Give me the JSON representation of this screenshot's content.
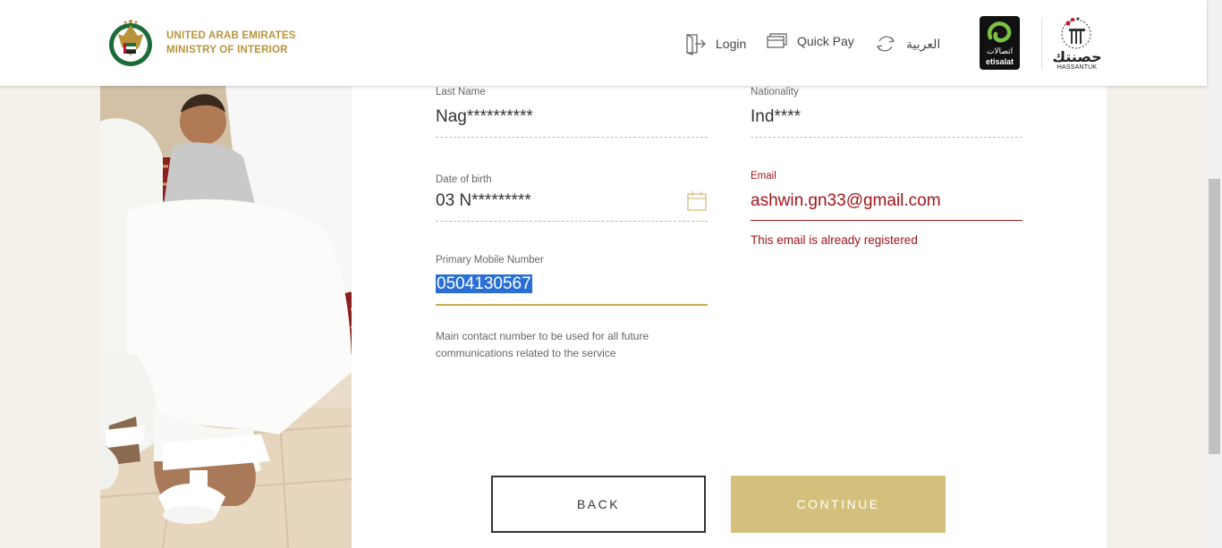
{
  "header": {
    "brand_line1": "UNITED ARAB EMIRATES",
    "brand_line2": "MINISTRY OF INTERIOR",
    "nav": {
      "login": "Login",
      "quick_pay": "Quick Pay",
      "language": "العربية"
    },
    "partners": {
      "etisalat_ar": "اتصالات",
      "etisalat_en": "etisalat",
      "hassantuk_ar": "حصنتك",
      "hassantuk_en": "HASSANTUK"
    }
  },
  "form": {
    "last_name": {
      "label": "Last Name",
      "value": "Nag**********"
    },
    "nationality": {
      "label": "Nationality",
      "value": "Ind****"
    },
    "dob": {
      "label": "Date of birth",
      "value": "03 N*********"
    },
    "email": {
      "label": "Email",
      "value": "ashwin.gn33@gmail.com",
      "error": "This email is already registered"
    },
    "mobile": {
      "label": "Primary Mobile Number",
      "value": "0504130567",
      "help": "Main contact number to be used for all future communications related to the service"
    }
  },
  "buttons": {
    "back": "BACK",
    "continue": "CONTINUE"
  },
  "colors": {
    "gold": "#b8933c",
    "error": "#a0141a",
    "continue_bg": "#d4c07d",
    "selection": "#2a6fd6"
  },
  "icons": [
    "uae-emblem-icon",
    "login-icon",
    "card-icon",
    "language-switch-icon",
    "calendar-icon"
  ]
}
